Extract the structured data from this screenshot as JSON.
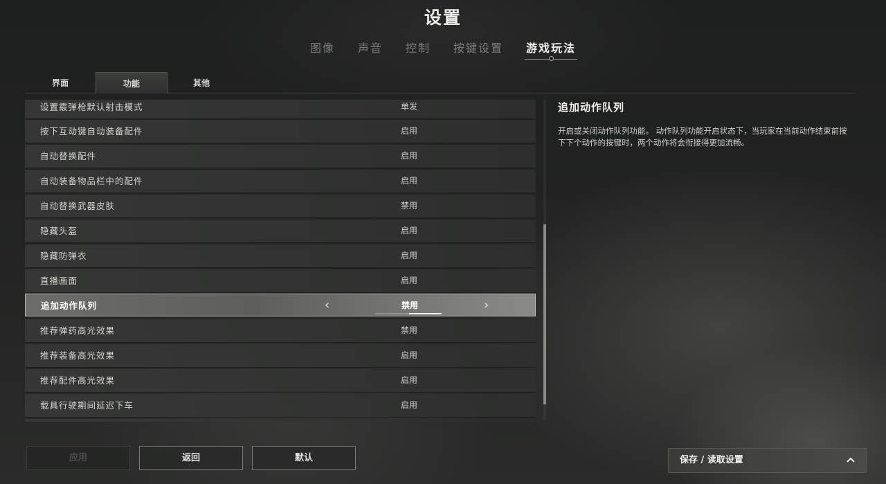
{
  "title": "设置",
  "top_tabs": [
    {
      "label": "图像"
    },
    {
      "label": "声音"
    },
    {
      "label": "控制"
    },
    {
      "label": "按键设置"
    },
    {
      "label": "游戏玩法",
      "active": true
    }
  ],
  "sub_tabs": [
    {
      "label": "界面"
    },
    {
      "label": "功能",
      "active": true
    },
    {
      "label": "其他"
    }
  ],
  "settings": [
    {
      "label": "设置霰弹枪默认射击模式",
      "value": "单发"
    },
    {
      "label": "按下互动键自动装备配件",
      "value": "启用"
    },
    {
      "label": "自动替换配件",
      "value": "启用"
    },
    {
      "label": "自动装备物品栏中的配件",
      "value": "启用"
    },
    {
      "label": "自动替换武器皮肤",
      "value": "禁用"
    },
    {
      "label": "隐藏头盔",
      "value": "启用"
    },
    {
      "label": "隐藏防弹衣",
      "value": "启用"
    },
    {
      "label": "直播画面",
      "value": "启用"
    },
    {
      "label": "追加动作队列",
      "value": "禁用",
      "selected": true,
      "option_index": 2,
      "option_count": 2
    },
    {
      "label": "推荐弹药高光效果",
      "value": "禁用"
    },
    {
      "label": "推荐装备高光效果",
      "value": "启用"
    },
    {
      "label": "推荐配件高光效果",
      "value": "启用"
    },
    {
      "label": "载具行驶期间延迟下车",
      "value": "启用"
    }
  ],
  "description": {
    "title": "追加动作队列",
    "body": "开启或关闭动作队列功能。 动作队列功能开启状态下，当玩家在当前动作结束前按下下个动作的按键时，两个动作将会衔接得更加流畅。"
  },
  "buttons": {
    "apply": "应用",
    "back": "返回",
    "default": "默认"
  },
  "save_load": {
    "label": "保存 / 读取设置",
    "icon": "chevron-up-icon"
  },
  "colors": {
    "selected_row": "#6c6d6a",
    "active_text": "#f2f2ef",
    "inactive_tab": "#7d7e7c"
  }
}
